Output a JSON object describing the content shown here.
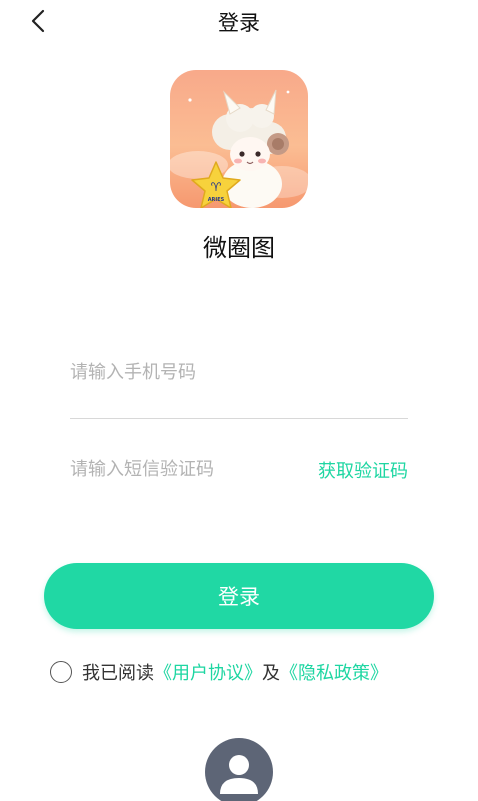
{
  "header": {
    "back_icon": "chevron-left-icon",
    "title": "登录"
  },
  "app": {
    "icon_name": "aries-sheep-app-icon",
    "icon_badge_text": "ARIES",
    "name": "微圈图"
  },
  "form": {
    "phone_placeholder": "请输入手机号码",
    "code_placeholder": "请输入短信验证码",
    "get_code_label": "获取验证码"
  },
  "login_button": {
    "label": "登录"
  },
  "agreement": {
    "prefix": "我已阅读",
    "user_agreement": "《用户协议》",
    "connector": "及",
    "privacy_policy": "《隐私政策》"
  },
  "other_login": {
    "icon": "user-avatar-icon"
  },
  "colors": {
    "accent": "#20d8a4",
    "link": "#1ed6a2",
    "avatar_bg": "#5d6576"
  }
}
